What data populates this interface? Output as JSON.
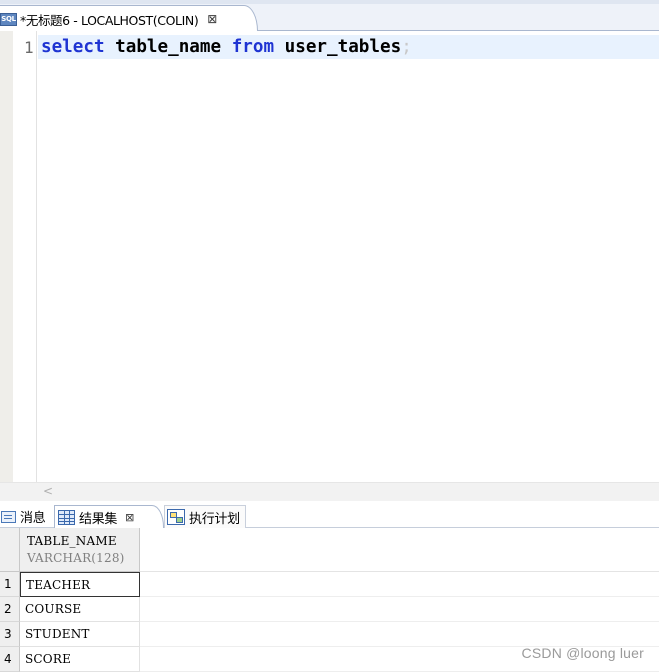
{
  "editor_tab": {
    "icon": "sql-file-icon",
    "icon_text": "SQL",
    "title": "*无标题6 - LOCALHOST(COLIN)",
    "close_glyph": "⊠"
  },
  "editor": {
    "line_number": "1",
    "code": {
      "kw_select": "select",
      "ident_1": "table_name",
      "kw_from": "from",
      "ident_2": "user_tables",
      "terminator": ";"
    },
    "scroll_left_glyph": "<"
  },
  "result_tabs": {
    "messages": "消息",
    "result_set": "结果集",
    "result_set_close": "⊠",
    "execution_plan": "执行计划"
  },
  "grid": {
    "columns": [
      {
        "name": "TABLE_NAME",
        "type": "VARCHAR(128)"
      }
    ],
    "rows": [
      {
        "num": "1",
        "value": "TEACHER"
      },
      {
        "num": "2",
        "value": "COURSE"
      },
      {
        "num": "3",
        "value": "STUDENT"
      },
      {
        "num": "4",
        "value": "SCORE"
      }
    ]
  },
  "watermark": "CSDN @loong luer",
  "colors": {
    "keyword": "#1f34d2",
    "current_line": "#e8f2fe",
    "tab_border": "#a9b7cf"
  }
}
